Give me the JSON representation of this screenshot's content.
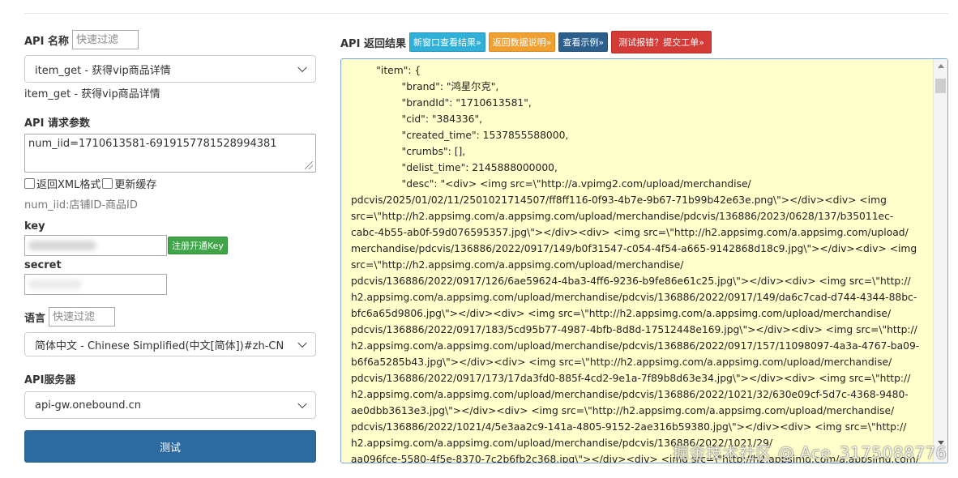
{
  "left": {
    "api_name_label": "API 名称",
    "api_filter_placeholder": "快速过滤",
    "api_select_value": "item_get - 获得vip商品详情",
    "api_selected_text": "item_get - 获得vip商品详情",
    "params_label": "API 请求参数",
    "params_value": "num_iid=1710613581-6919157781528994381",
    "checkbox_xml_label": "返回XML格式",
    "checkbox_cache_label": "更新缓存",
    "params_hint": "num_iid:店铺ID-商品ID",
    "key_label": "key",
    "register_key_button": "注册开通Key",
    "secret_label": "secret",
    "language_label": "语言",
    "language_filter_placeholder": "快速过滤",
    "language_select_value": "简体中文 - Chinese Simplified(中文[简体])#zh-CN",
    "server_label": "API服务器",
    "server_select_value": "api-gw.onebound.cn",
    "test_button": "测试"
  },
  "right": {
    "result_label": "API 返回结果",
    "btn_new_window": "新窗口查看结果»",
    "btn_return_doc": "返回数据说明»",
    "btn_example": "查看示例»",
    "btn_report": "测试报错？提交工单»",
    "result_text": "        \"item\": {\n                \"brand\": \"鸿星尔克\",\n                \"brandId\": \"1710613581\",\n                \"cid\": \"384336\",\n                \"created_time\": 1537855588000,\n                \"crumbs\": [],\n                \"delist_time\": 2145888000000,\n                \"desc\": \"<div> <img src=\\\"http://a.vpimg2.com/upload/merchandise/\npdcvis/2025/01/02/11/2501021714507/ff8ff116-0f93-4b7e-9b67-71b99b42e63e.png\\\"></div><div> <img\nsrc=\\\"http://h2.appsimg.com/a.appsimg.com/upload/merchandise/pdcvis/136886/2023/0628/137/b35011ec-\ncabc-4b55-ab0f-59d076595357.jpg\\\"></div><div> <img src=\\\"http://h2.appsimg.com/a.appsimg.com/upload/\nmerchandise/pdcvis/136886/2022/0917/149/b0f31547-c054-4f54-a665-9142868d18c9.jpg\\\"></div><div> <img\nsrc=\\\"http://h2.appsimg.com/a.appsimg.com/upload/merchandise/\npdcvis/136886/2022/0917/126/6ae59624-4ba3-4ff6-9236-b9fe86e61c25.jpg\\\"></div><div> <img src=\\\"http://\nh2.appsimg.com/a.appsimg.com/upload/merchandise/pdcvis/136886/2022/0917/149/da6c7cad-d744-4344-88bc-\nbfc6a65d9806.jpg\\\"></div><div> <img src=\\\"http://h2.appsimg.com/a.appsimg.com/upload/merchandise/\npdcvis/136886/2022/0917/183/5cd95b77-4987-4bfb-8d8d-17512448e169.jpg\\\"></div><div> <img src=\\\"http://\nh2.appsimg.com/a.appsimg.com/upload/merchandise/pdcvis/136886/2022/0917/157/11098097-4a3a-4767-ba09-\nb6f6a5285b43.jpg\\\"></div><div> <img src=\\\"http://h2.appsimg.com/a.appsimg.com/upload/merchandise/\npdcvis/136886/2022/0917/173/17da3fd0-885f-4cd2-9e1a-7f89b8d63e34.jpg\\\"></div><div> <img src=\\\"http://\nh2.appsimg.com/a.appsimg.com/upload/merchandise/pdcvis/136886/2022/1021/32/630e09cf-5d7c-4368-9480-\nae0dbb3613e3.jpg\\\"></div><div> <img src=\\\"http://h2.appsimg.com/a.appsimg.com/upload/merchandise/\npdcvis/136886/2022/1021/4/5e3aa2c9-141a-4805-9152-2ae316b59380.jpg\\\"></div><div> <img src=\\\"http://\nh2.appsimg.com/a.appsimg.com/upload/merchandise/pdcvis/136886/2022/1021/29/\naa096fce-5580-4f5e-8370-7c2b6fb2c368.jpg\\\"></div><div> <img src=\\\"http://h2.appsimg.com/a.appsimg.com/"
  },
  "watermark": "掘金技术社区 @ Ace_3175088776"
}
